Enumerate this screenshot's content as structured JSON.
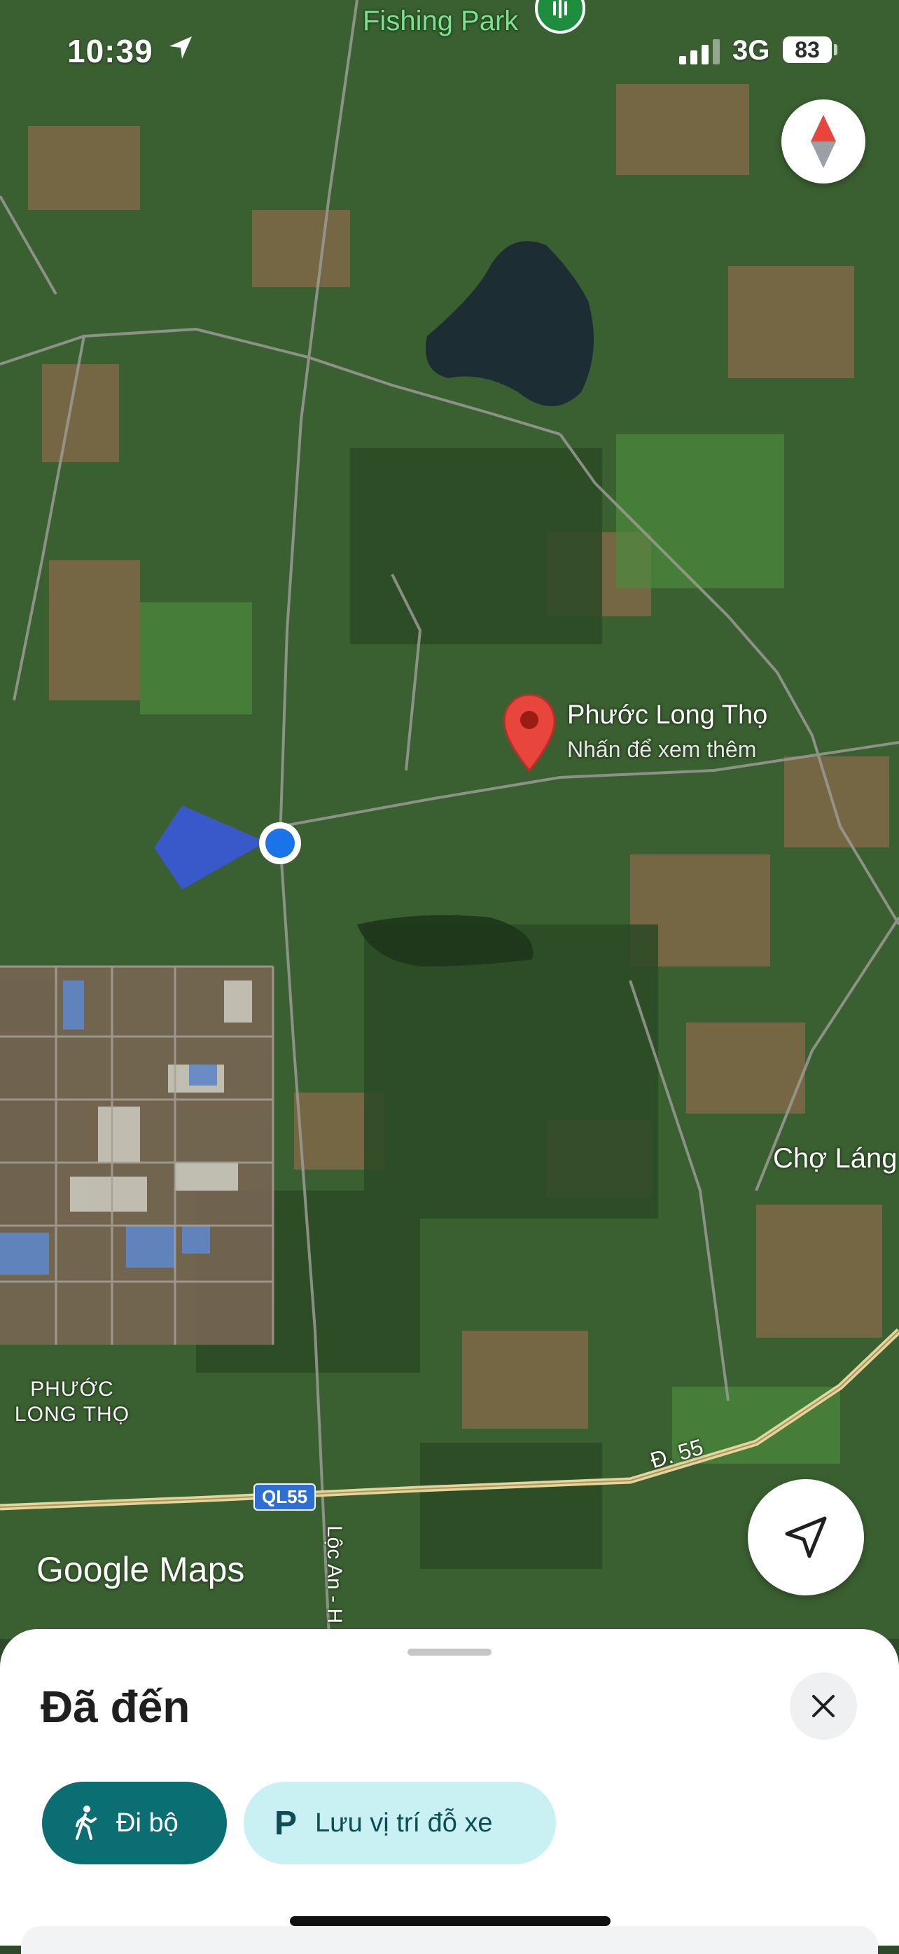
{
  "status_bar": {
    "time": "10:39",
    "network": "3G",
    "battery": "83"
  },
  "map": {
    "poi_top": "Fishing Park",
    "place_name": "Phước Long Thọ",
    "place_hint": "Nhấn để xem thêm",
    "label_cho_lang": "Chợ Láng",
    "label_area": "PHƯỚC LONG THỌ",
    "road_ql55": "QL55",
    "road_d55": "Đ. 55",
    "road_loc_an": "Lộc An - H",
    "logo": "Google Maps",
    "colors": {
      "pin_red": "#e8453c",
      "user_blue": "#1a73e8",
      "highway": "#e6d59a"
    }
  },
  "sheet": {
    "title": "Đã đến",
    "walk_label": "Đi bộ",
    "parking_glyph": "P",
    "parking_label": "Lưu vị trí đỗ xe",
    "icons": {
      "close": "close-icon",
      "walk": "walking-person-icon",
      "parking": "parking-icon"
    },
    "colors": {
      "walk_chip": "#0b6e73",
      "parking_chip": "#c9f1f3"
    }
  }
}
